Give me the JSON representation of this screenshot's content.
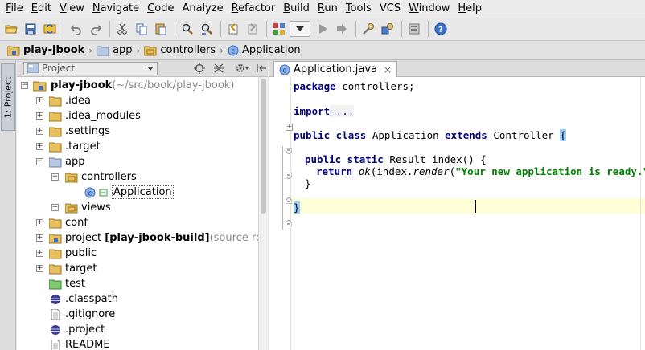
{
  "menu": {
    "items": [
      {
        "label": "File",
        "mnemonic": "F",
        "rest": "ile"
      },
      {
        "label": "Edit",
        "mnemonic": "E",
        "rest": "dit"
      },
      {
        "label": "View",
        "mnemonic": "V",
        "rest": "iew"
      },
      {
        "label": "Navigate",
        "mnemonic": "N",
        "rest": "avigate"
      },
      {
        "label": "Code",
        "mnemonic": "C",
        "rest": "ode"
      },
      {
        "label": "Analyze",
        "mnemonic": "",
        "rest": "Analyze"
      },
      {
        "label": "Refactor",
        "mnemonic": "R",
        "rest": "efactor"
      },
      {
        "label": "Build",
        "mnemonic": "B",
        "rest": "uild"
      },
      {
        "label": "Run",
        "mnemonic": "R",
        "rest": "un"
      },
      {
        "label": "Tools",
        "mnemonic": "T",
        "rest": "ools"
      },
      {
        "label": "VCS",
        "mnemonic": "",
        "rest": "VCS"
      },
      {
        "label": "Window",
        "mnemonic": "W",
        "rest": "indow"
      },
      {
        "label": "Help",
        "mnemonic": "H",
        "rest": "elp"
      }
    ]
  },
  "toolbar": {
    "icons": [
      "open-folder-icon",
      "save-icon",
      "sync-icon",
      "undo-icon",
      "redo-icon",
      "cut-icon",
      "copy-icon",
      "paste-icon",
      "find-icon",
      "replace-icon",
      "back-icon",
      "forward-icon",
      "structure-icon",
      "run-config-dropdown",
      "run-icon",
      "debug-icon",
      "settings-icon",
      "project-structure-icon",
      "sdk-icon",
      "help-icon"
    ]
  },
  "navbar": {
    "crumbs": [
      "play-jbook",
      "app",
      "controllers",
      "Application"
    ]
  },
  "stripe": {
    "tab_label": "1: Project"
  },
  "project_panel": {
    "view_label": "Project",
    "tree": [
      {
        "label": "play-jbook",
        "suffix": " (~/src/book/play-jbook)",
        "bold": true
      },
      {
        "label": ".idea"
      },
      {
        "label": ".idea_modules"
      },
      {
        "label": ".settings"
      },
      {
        "label": ".target"
      },
      {
        "label": "app"
      },
      {
        "label": "controllers"
      },
      {
        "label": "Application"
      },
      {
        "label": "views"
      },
      {
        "label": "conf"
      },
      {
        "label": "project",
        "bold_part": "[play-jbook-build]",
        "suffix": " (source ro"
      },
      {
        "label": "public"
      },
      {
        "label": "target"
      },
      {
        "label": "test"
      },
      {
        "label": ".classpath"
      },
      {
        "label": ".gitignore"
      },
      {
        "label": ".project"
      },
      {
        "label": "README"
      }
    ]
  },
  "editor": {
    "tab_label": "Application.java",
    "tab_close": "×",
    "code": {
      "line1_kw": "package",
      "line1_rest": " controllers;",
      "line2_kw": "import",
      "line2_folded": " ...",
      "line3_kw1": "public class",
      "line3_name": " Application ",
      "line3_kw2": "extends",
      "line3_rest": " Controller ",
      "line3_brace": "{",
      "line4_kw": "public static",
      "line4_rest": " Result index() {",
      "line5_kw": "return",
      "line5_sp": " ",
      "line5_ok": "ok",
      "line5_mid": "(index.",
      "line5_render": "render",
      "line5_open": "(",
      "line5_str": "\"Your new application is ready.\"",
      "line5_close": "));",
      "line6": "}",
      "line7": "}"
    }
  },
  "colors": {
    "keyword": "#000080",
    "string": "#008000",
    "caret_line": "#ffffd7",
    "selection_blue": "#99ccff"
  }
}
